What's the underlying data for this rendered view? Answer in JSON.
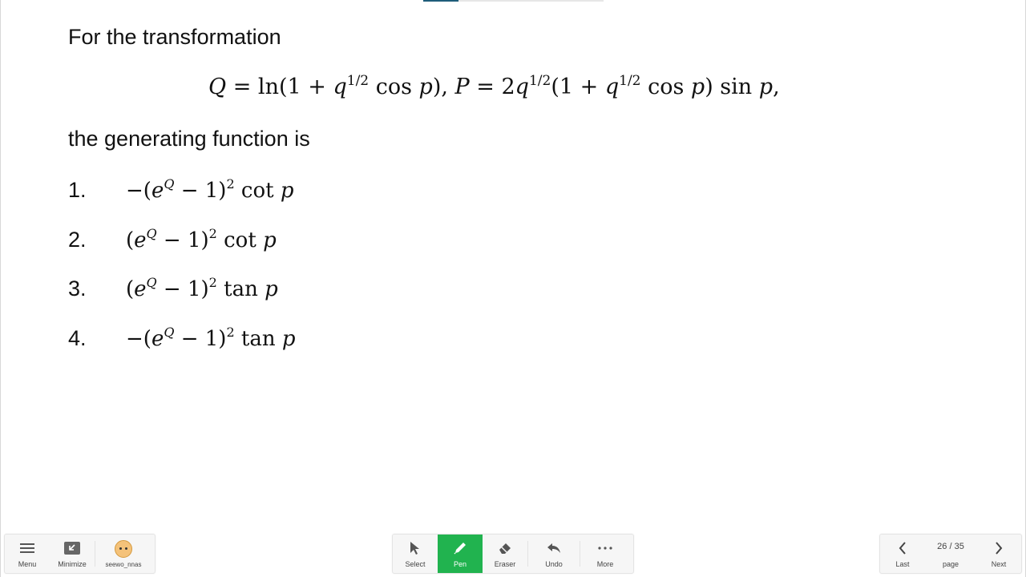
{
  "slide": {
    "intro": "For the transformation",
    "equation": {
      "Q": "Q",
      "eq1": " = ln(1 + ",
      "q": "q",
      "half": "1/2",
      "cosp": " cos ",
      "p": "p",
      "close1": "),",
      "P": "P",
      "eq2": " = 2",
      "q2": "q",
      "half2": "1/2",
      "open2": "(1 + ",
      "q3": "q",
      "half3": "1/2",
      "cosp2": " cos ",
      "p2": "p",
      "close2": ") sin ",
      "p3": "p",
      "end": ","
    },
    "generating": "the generating function is",
    "options": [
      {
        "num": "1.",
        "pre": "−(",
        "e": "e",
        "Qexp": "Q",
        "mid": " − 1)",
        "sq": "2",
        "fn": " cot ",
        "var": "p"
      },
      {
        "num": "2.",
        "pre": "(",
        "e": "e",
        "Qexp": "Q",
        "mid": " − 1)",
        "sq": "2",
        "fn": " cot ",
        "var": "p"
      },
      {
        "num": "3.",
        "pre": "(",
        "e": "e",
        "Qexp": "Q",
        "mid": " − 1)",
        "sq": "2",
        "fn": " tan ",
        "var": "p"
      },
      {
        "num": "4.",
        "pre": "−(",
        "e": "e",
        "Qexp": "Q",
        "mid": " − 1)",
        "sq": "2",
        "fn": " tan ",
        "var": "p"
      }
    ]
  },
  "toolbar_left": {
    "menu": "Menu",
    "minimize": "Minimize",
    "user": "seewo_nnas"
  },
  "toolbar_center": {
    "select": "Select",
    "pen": "Pen",
    "eraser": "Eraser",
    "undo": "Undo",
    "more": "More"
  },
  "toolbar_right": {
    "last": "Last",
    "page_num": "26 / 35",
    "page": "page",
    "next": "Next"
  },
  "colors": {
    "pen_active": "#21b34f",
    "toolbar_bg": "#f6f6f6"
  }
}
